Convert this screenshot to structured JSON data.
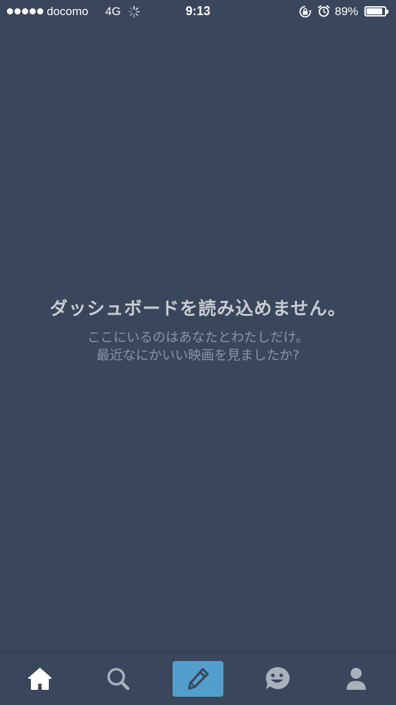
{
  "status_bar": {
    "carrier": "docomo",
    "network": "4G",
    "time": "9:13",
    "battery_percent": "89%",
    "battery_level": 0.89,
    "signal_bars": 5,
    "icons": [
      "loading-spinner-icon",
      "rotation-lock-icon",
      "alarm-icon",
      "battery-icon"
    ]
  },
  "empty_state": {
    "title": "ダッシュボードを読み込めません。",
    "line1": "ここにいるのはあなたとわたしだけ。",
    "line2": "最近なにかいい映画を見ましたか?"
  },
  "tab_bar": {
    "items": [
      {
        "name": "home",
        "icon": "home-icon",
        "active": true
      },
      {
        "name": "search",
        "icon": "search-icon",
        "active": false
      },
      {
        "name": "compose",
        "icon": "pencil-icon",
        "active": false
      },
      {
        "name": "activity",
        "icon": "smiley-chat-icon",
        "active": false
      },
      {
        "name": "account",
        "icon": "person-icon",
        "active": false
      }
    ]
  },
  "colors": {
    "background": "#39465b",
    "compose_accent": "#529ecc",
    "inactive_icon": "#a9b1bd",
    "active_icon": "#ffffff"
  }
}
